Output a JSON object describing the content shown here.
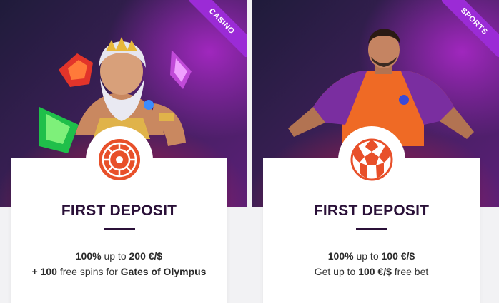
{
  "colors": {
    "accent": "#e8502a",
    "ribbon": "#9b2bd6",
    "title": "#2a1038"
  },
  "casino": {
    "ribbon_label": "CASINO",
    "icon": "roulette-icon",
    "title": "FIRST DEPOSIT",
    "line1": {
      "strong1": "100%",
      "text1": " up to ",
      "strong2": "200 €/$"
    },
    "line2": {
      "strong1": "+ 100",
      "text1": " free spins for ",
      "strong2": "Gates of Olympus"
    }
  },
  "sports": {
    "ribbon_label": "SPORTS",
    "icon": "soccer-ball-icon",
    "title": "FIRST DEPOSIT",
    "line1": {
      "strong1": "100%",
      "text1": " up to ",
      "strong2": "100 €/$"
    },
    "line2": {
      "text0": "Get up to ",
      "strong1": "100 €/$",
      "text1": " free bet"
    }
  }
}
